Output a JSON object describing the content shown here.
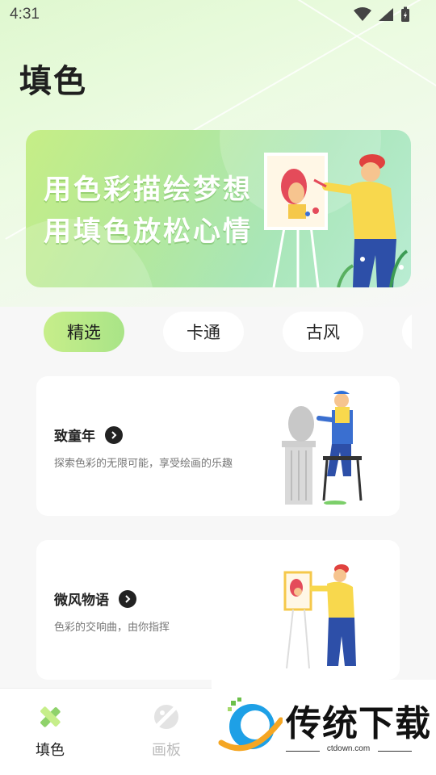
{
  "status_bar": {
    "time": "4:31"
  },
  "page": {
    "title": "填色"
  },
  "banner": {
    "line1": "用色彩描绘梦想",
    "line2": "用填色放松心情"
  },
  "tabs": [
    {
      "label": "精选",
      "active": true
    },
    {
      "label": "卡通",
      "active": false
    },
    {
      "label": "古风",
      "active": false
    }
  ],
  "cards": [
    {
      "title": "致童年",
      "subtitle": "探索色彩的无限可能，享受绘画的乐趣"
    },
    {
      "title": "微风物语",
      "subtitle": "色彩的交响曲，由你指挥"
    }
  ],
  "bottom_nav": [
    {
      "label": "填色",
      "icon": "ruler-pencil-icon",
      "active": true
    },
    {
      "label": "画板",
      "icon": "palette-icon",
      "active": false
    }
  ],
  "watermark": {
    "text": "传统下载",
    "url": "ctdown.com"
  },
  "colors": {
    "accent_green": "#b6e889",
    "text_dark": "#222222"
  }
}
